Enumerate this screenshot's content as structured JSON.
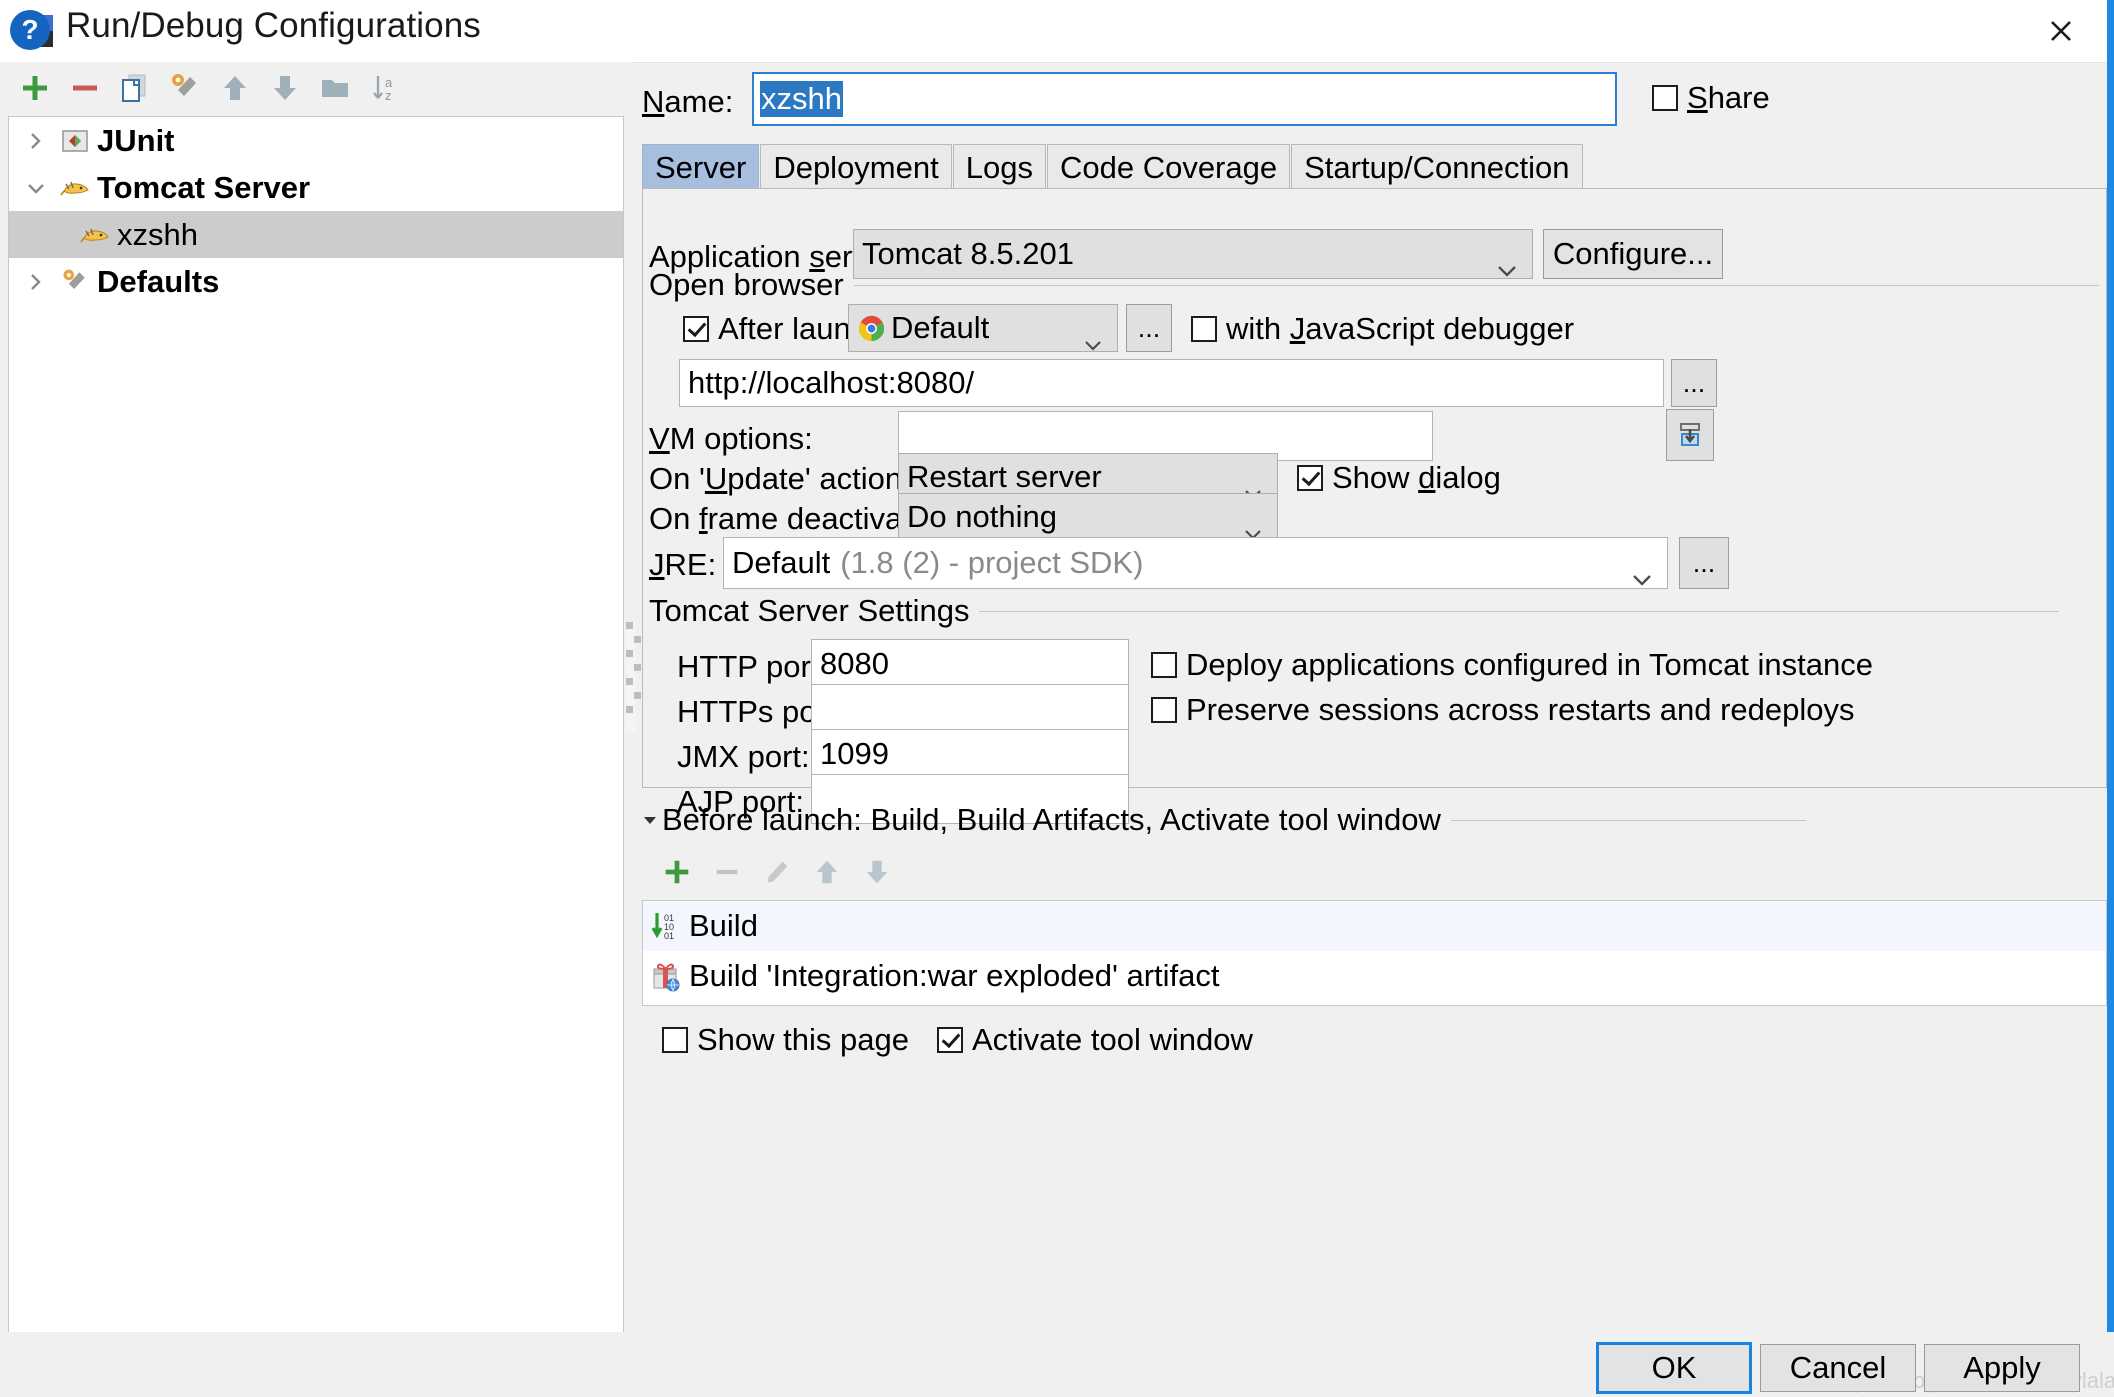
{
  "window": {
    "title": "Run/Debug Configurations",
    "app_icon": "intellij-idea-icon",
    "close_icon": "close-icon"
  },
  "left_panel": {
    "toolbar": [
      {
        "name": "add-configuration-button",
        "icon": "plus-icon",
        "label": "+"
      },
      {
        "name": "remove-configuration-button",
        "icon": "minus-icon",
        "label": "−"
      },
      {
        "name": "copy-configuration-button",
        "icon": "copy-icon",
        "label": ""
      },
      {
        "name": "edit-defaults-button",
        "icon": "wrench-icon",
        "label": ""
      },
      {
        "name": "move-up-button",
        "icon": "arrow-up-icon",
        "label": ""
      },
      {
        "name": "move-down-button",
        "icon": "arrow-down-icon",
        "label": ""
      },
      {
        "name": "create-folder-button",
        "icon": "folder-icon",
        "label": ""
      },
      {
        "name": "sort-configurations-button",
        "icon": "sort-az-icon",
        "label": ""
      }
    ],
    "tree": [
      {
        "label": "JUnit",
        "icon": "junit-icon",
        "twisty": "collapsed",
        "level": 0,
        "selected": false
      },
      {
        "label": "Tomcat Server",
        "icon": "tomcat-icon",
        "twisty": "expanded",
        "level": 0,
        "selected": false
      },
      {
        "label": "xzshh",
        "icon": "tomcat-icon",
        "twisty": "none",
        "level": 1,
        "selected": true
      },
      {
        "label": "Defaults",
        "icon": "wrench-icon",
        "twisty": "collapsed",
        "level": 0,
        "selected": false
      }
    ]
  },
  "name_row": {
    "label": "Name:",
    "value": "xzshh",
    "share_label": "Share",
    "share_checked": false
  },
  "tabs": [
    {
      "label": "Server",
      "active": true
    },
    {
      "label": "Deployment",
      "active": false
    },
    {
      "label": "Logs",
      "active": false
    },
    {
      "label": "Code Coverage",
      "active": false
    },
    {
      "label": "Startup/Connection",
      "active": false
    }
  ],
  "server_tab": {
    "application_server": {
      "label": "Application server:",
      "value": "Tomcat 8.5.201",
      "configure_button": "Configure..."
    },
    "open_browser": {
      "group_title": "Open browser",
      "after_launch_label": "After launch",
      "after_launch_checked": true,
      "browser_value": "Default",
      "browser_icon": "chrome-icon",
      "browse_button": "...",
      "js_debugger_label": "with JavaScript debugger",
      "js_debugger_checked": false,
      "url_value": "http://localhost:8080/",
      "url_browse_button": "..."
    },
    "vm_options": {
      "label": "VM options:",
      "value": "",
      "expand_button_icon": "expand-editor-icon"
    },
    "on_update_action": {
      "label": "On 'Update' action:",
      "value": "Restart server",
      "show_dialog_label": "Show dialog",
      "show_dialog_checked": true
    },
    "on_frame_deactivation": {
      "label": "On frame deactivation:",
      "value": "Do nothing"
    },
    "jre": {
      "label": "JRE:",
      "value": "Default",
      "hint": "(1.8 (2) - project SDK)",
      "browse_button": "..."
    },
    "tomcat_settings": {
      "group_title": "Tomcat Server Settings",
      "ports": [
        {
          "label": "HTTP port:",
          "value": "8080",
          "name": "http-port-input"
        },
        {
          "label": "HTTPs port:",
          "value": "",
          "name": "https-port-input"
        },
        {
          "label": "JMX port:",
          "value": "1099",
          "name": "jmx-port-input"
        },
        {
          "label": "AJP port:",
          "value": "",
          "name": "ajp-port-input"
        }
      ],
      "checkboxes": [
        {
          "label": "Deploy applications configured in Tomcat instance",
          "checked": false,
          "name": "deploy-applications-checkbox"
        },
        {
          "label": "Preserve sessions across restarts and redeploys",
          "checked": false,
          "name": "preserve-sessions-checkbox"
        }
      ]
    }
  },
  "before_launch": {
    "title": "Before launch: Build, Build Artifacts, Activate tool window",
    "toolbar": [
      {
        "name": "add-task-button",
        "icon": "plus-icon"
      },
      {
        "name": "remove-task-button",
        "icon": "minus-icon"
      },
      {
        "name": "edit-task-button",
        "icon": "pencil-icon"
      },
      {
        "name": "move-task-up-button",
        "icon": "arrow-up-icon"
      },
      {
        "name": "move-task-down-button",
        "icon": "arrow-down-icon"
      }
    ],
    "tasks": [
      {
        "label": "Build",
        "icon": "build-icon",
        "highlighted": true
      },
      {
        "label": "Build 'Integration:war exploded' artifact",
        "icon": "artifact-icon",
        "highlighted": false
      }
    ],
    "show_this_page_label": "Show this page",
    "show_this_page_checked": false,
    "activate_tool_window_label": "Activate tool window",
    "activate_tool_window_checked": true
  },
  "footer": {
    "help_label": "?",
    "ok_label": "OK",
    "cancel_label": "Cancel",
    "apply_label": "Apply",
    "watermark": "https://blog.csdn.net/marylala"
  },
  "colors": {
    "accent_blue": "#1a84dc",
    "selection_blue": "#2b79c2",
    "tab_active": "#a7bede",
    "tree_selection": "#cccccc",
    "panel_bg": "#f0f0f0"
  }
}
